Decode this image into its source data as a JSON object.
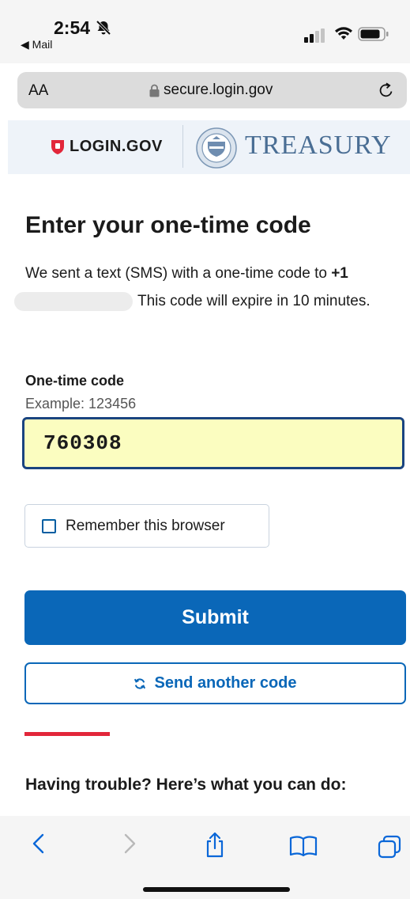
{
  "status_bar": {
    "time": "2:54",
    "back_app": "◀ Mail",
    "icons": [
      "bell-slash-icon",
      "signal-icon",
      "wifi-icon",
      "battery-icon"
    ]
  },
  "browser": {
    "text_size_label": "AA",
    "url": "secure.login.gov",
    "icons": [
      "lock-icon",
      "reload-icon"
    ]
  },
  "header": {
    "logo_text": "LOGIN.GOV",
    "partner_text": "TREASURY",
    "icons": [
      "login-shield-icon",
      "treasury-seal-icon"
    ]
  },
  "main": {
    "title": "Enter your one-time code",
    "description_before": "We sent a text (SMS) with a one-time code to ",
    "phone_prefix": "+1",
    "description_after": "This code will expire in 10 minutes."
  },
  "form": {
    "code_label": "One-time code",
    "code_hint": "Example: 123456",
    "code_value": "760308",
    "remember_label": "Remember this browser",
    "remember_checked": false,
    "submit_label": "Submit",
    "send_another_label": "Send another code"
  },
  "help": {
    "heading": "Having trouble? Here’s what you can do:"
  },
  "toolbar": {
    "icons": [
      "back-arrow-icon",
      "forward-arrow-icon",
      "share-icon",
      "bookmarks-icon",
      "tabs-icon"
    ]
  },
  "colors": {
    "primary": "#0a67b8",
    "accent_red": "#e2263a",
    "input_highlight": "#fbfdc0",
    "treasury_blue": "#4a6e94"
  }
}
